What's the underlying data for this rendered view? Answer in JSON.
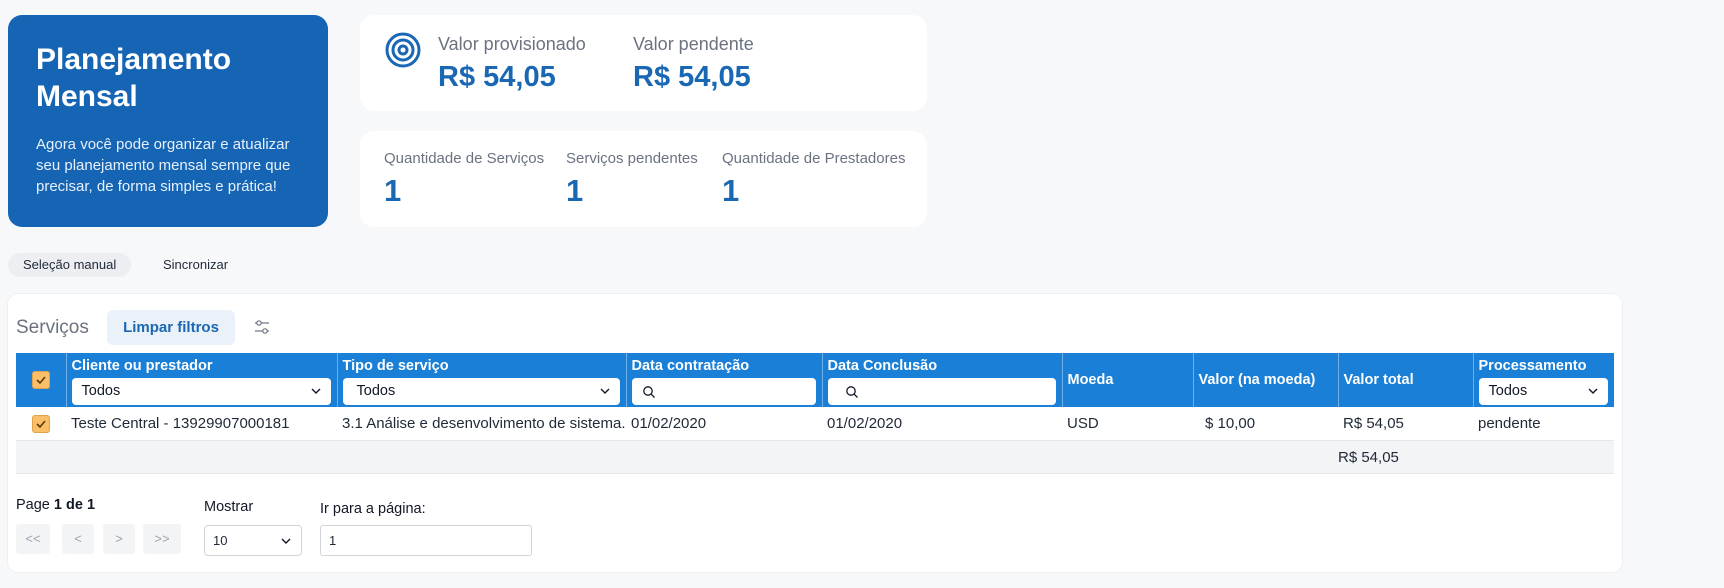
{
  "hero": {
    "title_line1": "Planejamento",
    "title_line2": "Mensal",
    "description_line1": "Agora você pode organizar e atualizar",
    "description_line2": "seu planejamento mensal sempre que",
    "description_line3": "precisar, de forma simples e prática!"
  },
  "values": {
    "provisioned_label": "Valor provisionado",
    "provisioned_value": "R$ 54,05",
    "pending_label": "Valor pendente",
    "pending_value": "R$ 54,05"
  },
  "counts": {
    "services_label": "Quantidade de Serviços",
    "services_value": "1",
    "pending_label": "Serviços pendentes",
    "pending_value": "1",
    "providers_label": "Quantidade de Prestadores",
    "providers_value": "1"
  },
  "actions": {
    "manual": "Seleção manual",
    "sync": "Sincronizar"
  },
  "panel": {
    "title": "Serviços",
    "clear_filters": "Limpar filtros"
  },
  "table": {
    "headers": [
      "Cliente ou prestador",
      "Tipo de serviço",
      "Data contratação",
      "Data Conclusão",
      "Moeda",
      "Valor (na moeda)",
      "Valor total",
      "Processamento"
    ],
    "filters": {
      "client": "Todos",
      "service_type": "Todos",
      "processing": "Todos"
    },
    "row": {
      "client": "Teste Central - 13929907000181",
      "service_type": "3.1 Análise e desenvolvimento de sistema.",
      "contract_date": "01/02/2020",
      "completion_date": "01/02/2020",
      "currency": "USD",
      "value_currency": "$ 10,00",
      "total_value": "R$ 54,05",
      "processing": "pendente"
    },
    "footer_total": "R$ 54,05"
  },
  "pagination": {
    "page_prefix": "Page",
    "page_info": "1 de 1",
    "first": "<<",
    "prev": "<",
    "next": ">",
    "last": ">>",
    "show_label": "Mostrar",
    "show_value": "10",
    "goto_label": "Ir para a página:",
    "goto_value": "1"
  },
  "colors": {
    "brand_blue": "#1565b4",
    "header_blue": "#1a7fd6",
    "checkbox": "#fbbf6a"
  }
}
